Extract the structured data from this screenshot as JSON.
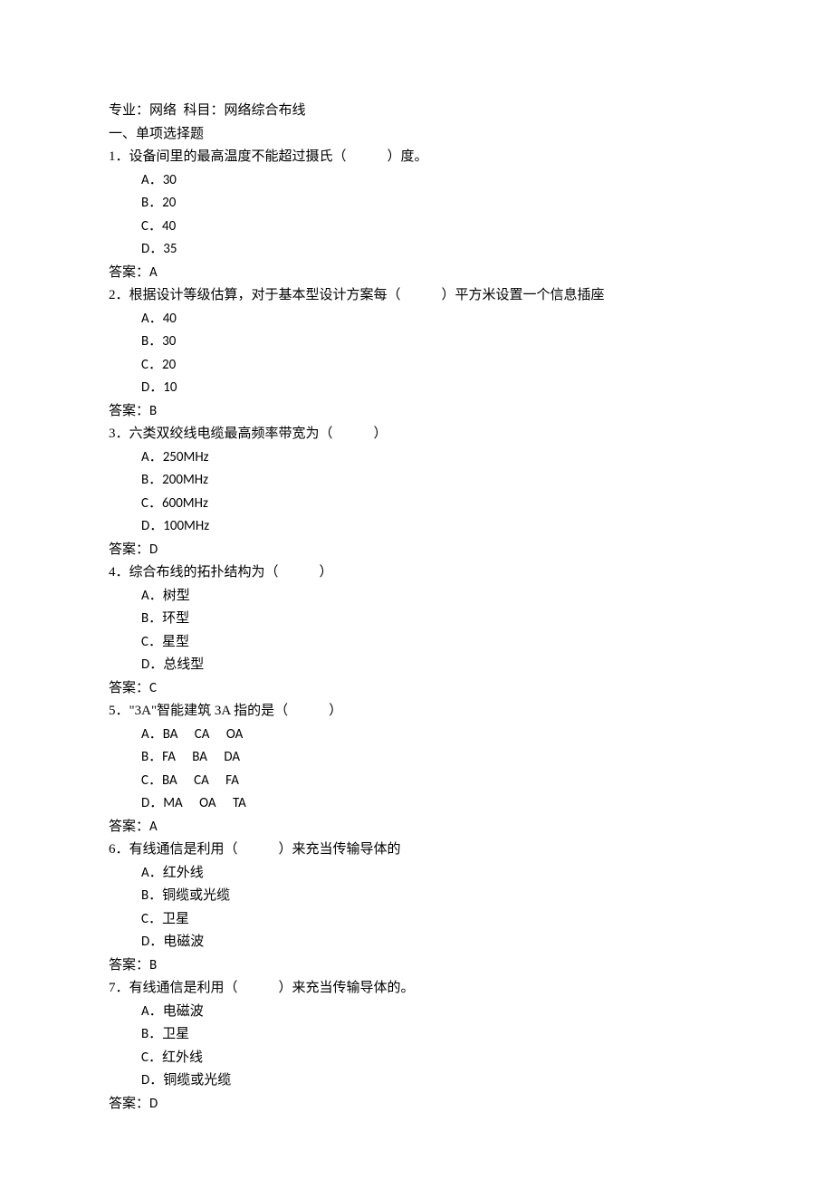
{
  "header": {
    "major_label": "专业：",
    "major_value": "网络",
    "subject_label": "科目：",
    "subject_value": "网络综合布线"
  },
  "section_title": "一、单项选择题",
  "answer_label": "答案：",
  "questions": [
    {
      "num": "1．",
      "text_pre": "设备间里的最高温度不能超过摄氏（",
      "text_post": "）度。",
      "options": [
        {
          "label": "A．",
          "text": "30"
        },
        {
          "label": "B．",
          "text": "20"
        },
        {
          "label": "C．",
          "text": "40"
        },
        {
          "label": "D．",
          "text": "35"
        }
      ],
      "answer": "A"
    },
    {
      "num": "2．",
      "text_pre": "根据设计等级估算，对于基本型设计方案每（",
      "text_post": "）平方米设置一个信息插座",
      "options": [
        {
          "label": "A．",
          "text": "40"
        },
        {
          "label": "B．",
          "text": "30"
        },
        {
          "label": "C．",
          "text": "20"
        },
        {
          "label": "D．",
          "text": "10"
        }
      ],
      "answer": "B"
    },
    {
      "num": "3．",
      "text_pre": "六类双绞线电缆最高频率带宽为（",
      "text_post": "）",
      "options": [
        {
          "label": "A．",
          "text": "250MHz"
        },
        {
          "label": "B．",
          "text": "200MHz"
        },
        {
          "label": "C．",
          "text": "600MHz"
        },
        {
          "label": "D．",
          "text": "100MHz"
        }
      ],
      "answer": "D"
    },
    {
      "num": "4．",
      "text_pre": "综合布线的拓扑结构为（",
      "text_post": "）",
      "options": [
        {
          "label": "A．",
          "text": "树型"
        },
        {
          "label": "B．",
          "text": "环型"
        },
        {
          "label": "C．",
          "text": "星型"
        },
        {
          "label": "D．",
          "text": "总线型"
        }
      ],
      "answer": "C"
    },
    {
      "num": "5．",
      "text_pre": "\"3A\"智能建筑 3A 指的是（",
      "text_post": "）",
      "options": [
        {
          "label": "A．",
          "text": "BA　 CA　 OA"
        },
        {
          "label": "B．",
          "text": "FA　 BA　 DA"
        },
        {
          "label": "C．",
          "text": "BA　 CA　 FA"
        },
        {
          "label": "D．",
          "text": "MA　 OA　 TA"
        }
      ],
      "answer": "A"
    },
    {
      "num": "6．",
      "text_pre": "有线通信是利用（",
      "text_post": "）来充当传输导体的",
      "options": [
        {
          "label": "A．",
          "text": "红外线"
        },
        {
          "label": "B．",
          "text": "铜缆或光缆"
        },
        {
          "label": "C．",
          "text": "卫星"
        },
        {
          "label": "D．",
          "text": "电磁波"
        }
      ],
      "answer": "B"
    },
    {
      "num": "7．",
      "text_pre": "有线通信是利用（",
      "text_post": "）来充当传输导体的。",
      "options": [
        {
          "label": "A．",
          "text": "电磁波"
        },
        {
          "label": "B．",
          "text": "卫星"
        },
        {
          "label": "C．",
          "text": "红外线"
        },
        {
          "label": "D．",
          "text": "铜缆或光缆"
        }
      ],
      "answer": "D"
    }
  ]
}
